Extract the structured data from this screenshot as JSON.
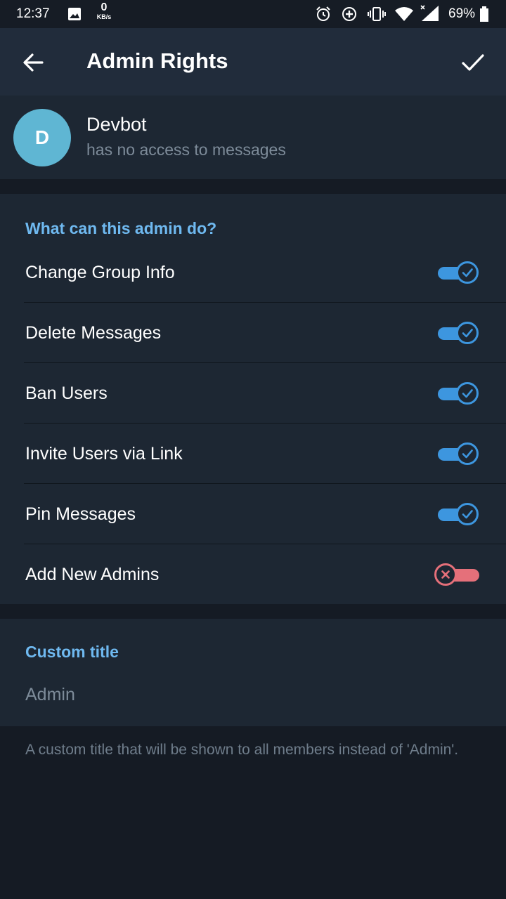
{
  "status_bar": {
    "time": "12:37",
    "net_speed_value": "0",
    "net_speed_unit": "KB/s",
    "battery": "69%"
  },
  "app_bar": {
    "title": "Admin Rights",
    "back_icon": "arrow-left-icon",
    "done_icon": "checkmark-icon"
  },
  "profile": {
    "initial": "D",
    "name": "Devbot",
    "subtitle": "has no access to messages",
    "avatar_color": "#5fb6d3"
  },
  "permissions": {
    "header": "What can this admin do?",
    "items": [
      {
        "label": "Change Group Info",
        "enabled": true
      },
      {
        "label": "Delete Messages",
        "enabled": true
      },
      {
        "label": "Ban Users",
        "enabled": true
      },
      {
        "label": "Invite Users via Link",
        "enabled": true
      },
      {
        "label": "Pin Messages",
        "enabled": true
      },
      {
        "label": "Add New Admins",
        "enabled": false
      }
    ]
  },
  "custom_title": {
    "header": "Custom title",
    "placeholder": "Admin",
    "hint": "A custom title that will be shown to all members instead of 'Admin'."
  },
  "colors": {
    "accent": "#6fb9f0",
    "toggle_on": "#3d96df",
    "toggle_off": "#e5707a",
    "app_bar": "#212c3b",
    "surface": "#1d2733",
    "background": "#151b24"
  }
}
